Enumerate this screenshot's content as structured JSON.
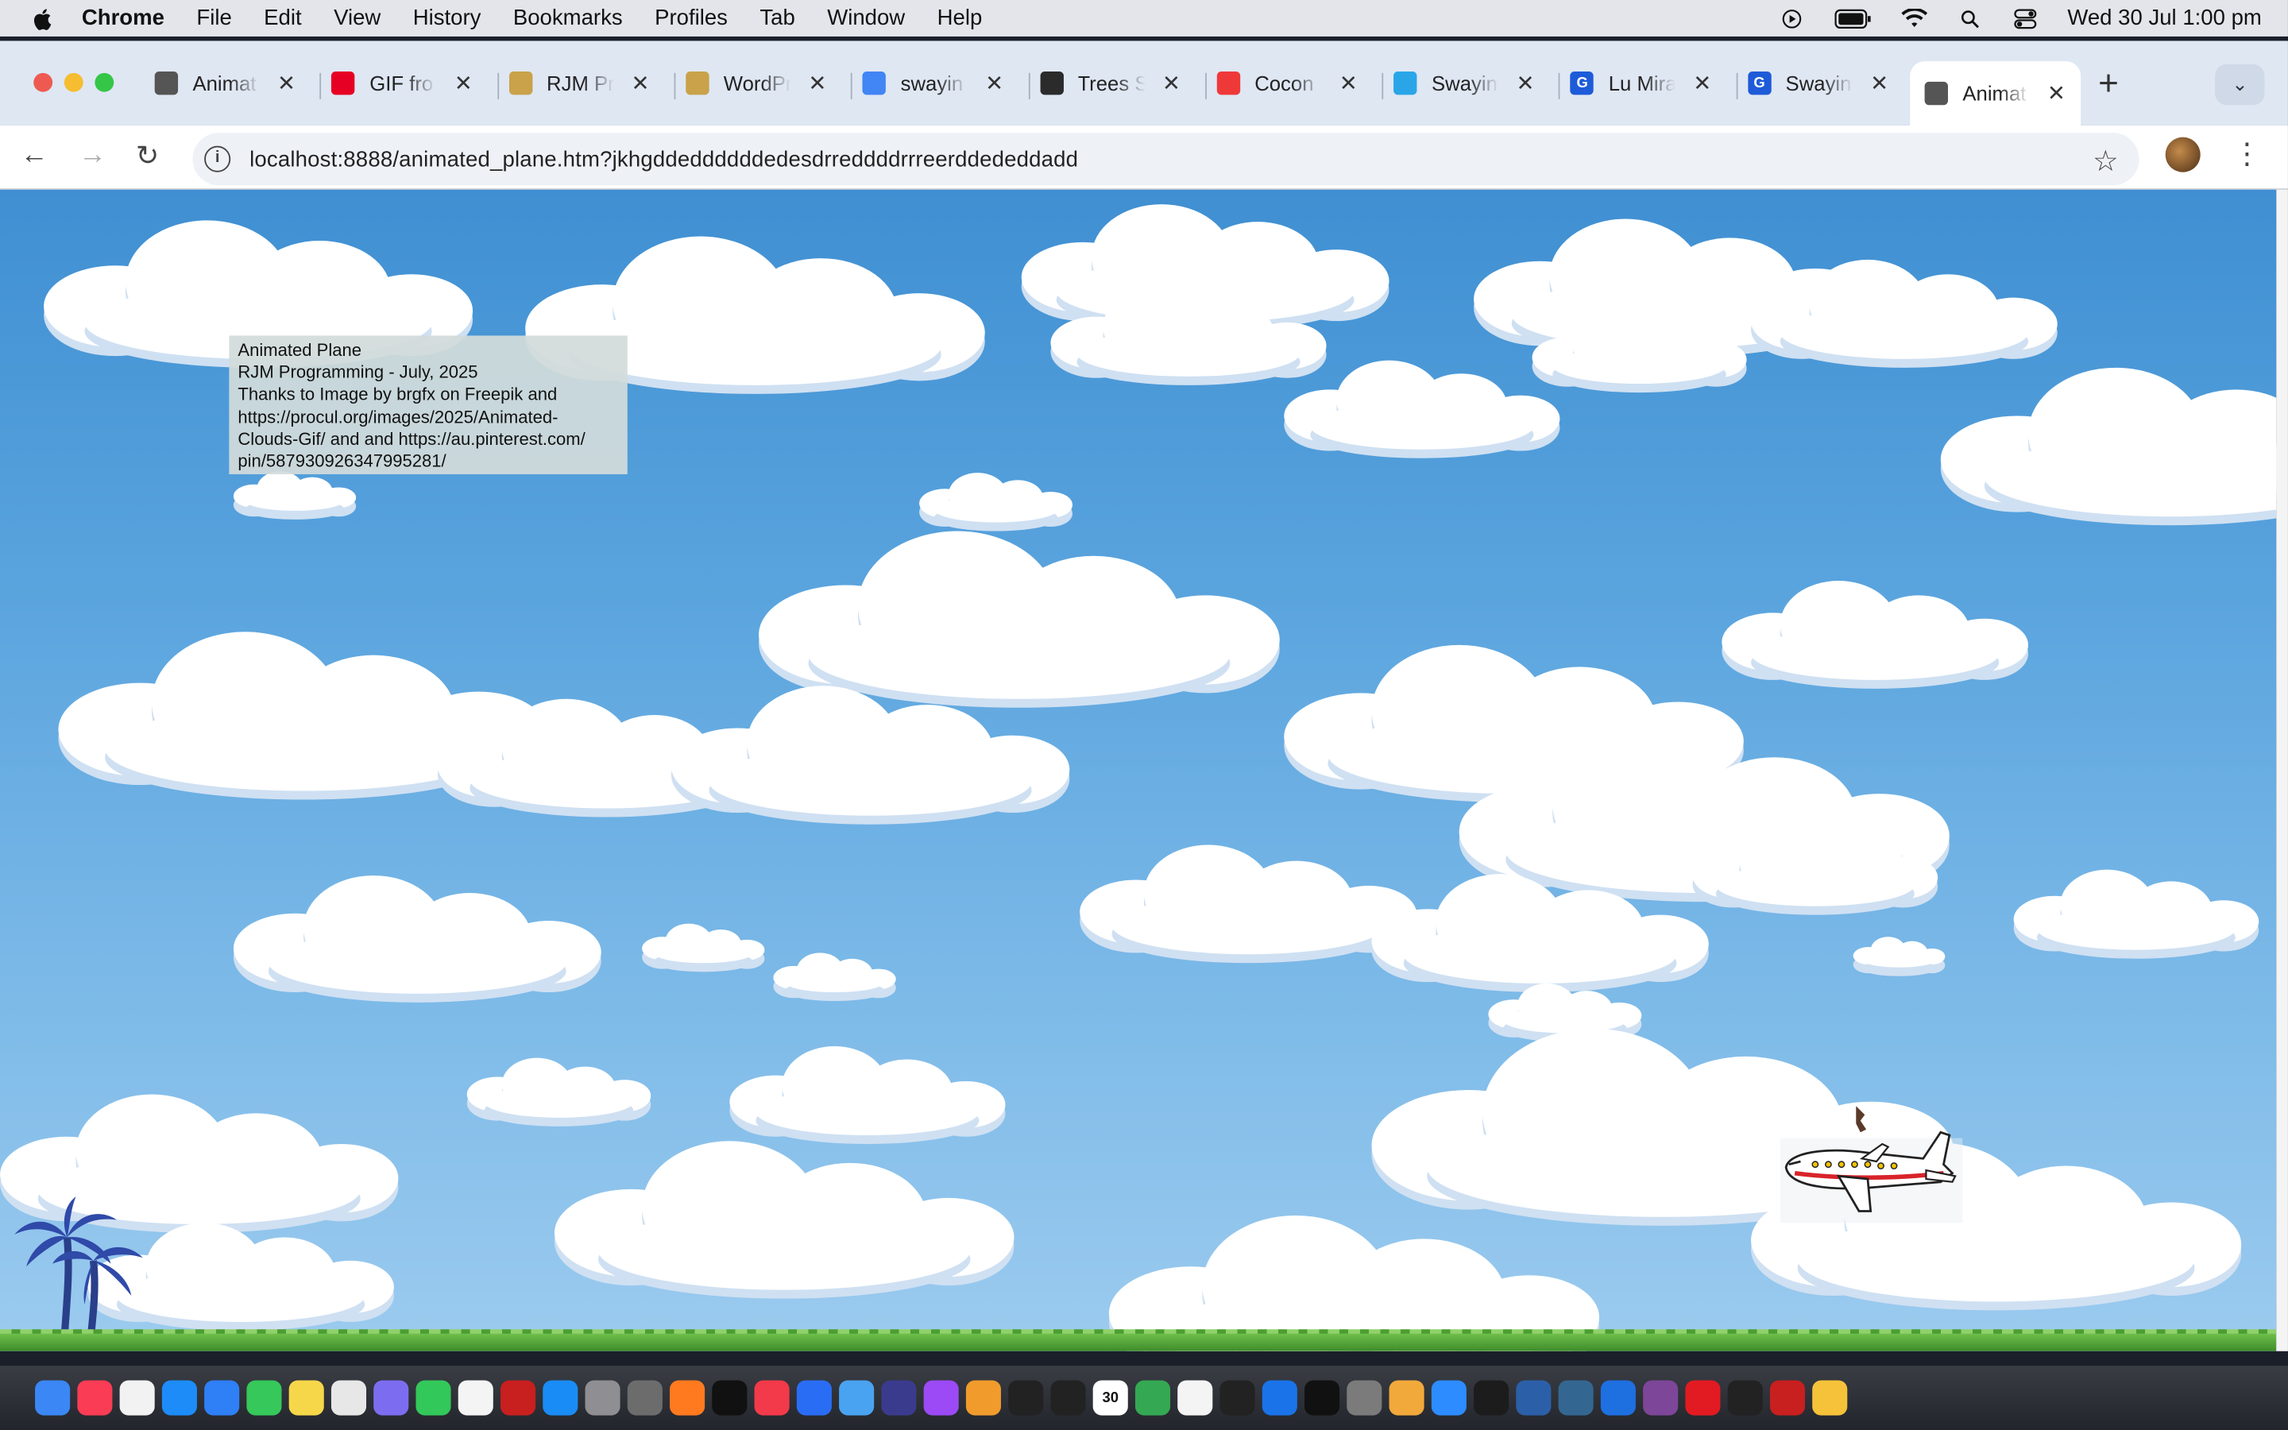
{
  "menubar": {
    "app": "Chrome",
    "items": [
      "File",
      "Edit",
      "View",
      "History",
      "Bookmarks",
      "Profiles",
      "Tab",
      "Window",
      "Help"
    ],
    "clock": "Wed 30 Jul  1:00 pm"
  },
  "tabs": [
    {
      "title": "Animat",
      "icon": "github-icon",
      "color": "#555"
    },
    {
      "title": "GIF fro",
      "icon": "pinterest-icon",
      "color": "#e60023"
    },
    {
      "title": "RJM Pr",
      "icon": "rjm-icon",
      "color": "#c9a24a"
    },
    {
      "title": "WordPr",
      "icon": "rjm-icon",
      "color": "#c9a24a"
    },
    {
      "title": "swayin",
      "icon": "google-icon",
      "color": "#4285f4"
    },
    {
      "title": "Trees S",
      "icon": "trees-icon",
      "color": "#2b2b2b"
    },
    {
      "title": "Cocon",
      "icon": "vivaldi-icon",
      "color": "#ef3939"
    },
    {
      "title": "Swayin",
      "icon": "search-icon",
      "color": "#2aa6e8"
    },
    {
      "title": "Lu Mira",
      "icon": "gif-icon",
      "color": "#1e5bd8"
    },
    {
      "title": "Swayin",
      "icon": "gif-icon",
      "color": "#1e5bd8"
    },
    {
      "title": "Animat",
      "icon": "github-icon",
      "color": "#555",
      "active": true
    }
  ],
  "toolbar": {
    "url": "localhost:8888/animated_plane.htm?jkhgddeddddddedesdrreddddrrreerddededdadd"
  },
  "page": {
    "info_lines": [
      "Animated Plane",
      "RJM Programming - July, 2025",
      "Thanks to Image by brgfx on Freepik and",
      "https://procul.org/images/2025/Animated-",
      "Clouds-Gif/ and  and https://au.pinterest.com/",
      "pin/587930926347995281/"
    ]
  },
  "dock": {
    "apps": [
      "finder-icon",
      "music-icon",
      "reminders-icon",
      "safari-icon",
      "mail-icon",
      "messages-icon",
      "notes-icon",
      "activity-icon",
      "launchpad-icon",
      "facetime-icon",
      "file-icon",
      "filezilla-icon",
      "appstore-icon",
      "calculator-icon",
      "gimp-icon",
      "firefox-icon",
      "appletv-icon",
      "news-icon",
      "xcode-icon",
      "preview-icon",
      "bbedit-icon",
      "podcasts-icon",
      "books-icon",
      "terminal-icon",
      "terminal-icon",
      "calendar-icon",
      "chrome-icon",
      "file-icon",
      "terminal-icon",
      "quicktime-icon",
      "intellij-icon",
      "settings-icon",
      "photos-icon",
      "zoom-icon",
      "tent-icon",
      "inkscape-icon",
      "postgres-icon",
      "xcode-icon",
      "tor-icon",
      "opera-icon",
      "compass-icon",
      "filezilla-icon",
      "light-icon"
    ],
    "calendar_day": "30"
  }
}
